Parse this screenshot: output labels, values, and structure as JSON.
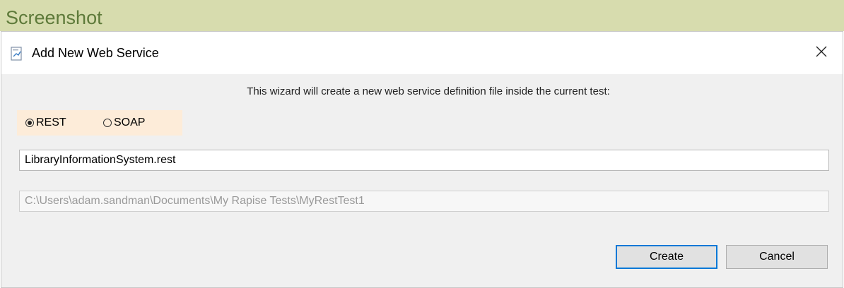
{
  "banner": {
    "title": "Screenshot"
  },
  "dialog": {
    "title": "Add New Web Service",
    "title_icon": "document-icon",
    "close_icon": "close-icon",
    "intro_text": "This wizard will create a new web service definition file inside the current test:",
    "service_type": {
      "options": [
        "REST",
        "SOAP"
      ],
      "selected": "REST"
    },
    "file_name": {
      "value": "LibraryInformationSystem.rest"
    },
    "folder_path": {
      "value": "C:\\Users\\adam.sandman\\Documents\\My Rapise Tests\\MyRestTest1"
    },
    "buttons": {
      "create": "Create",
      "cancel": "Cancel"
    }
  },
  "colors": {
    "banner_bg": "#d7dcae",
    "banner_text": "#5e7a3a",
    "radio_group_bg": "#fdecd9",
    "primary_border": "#0078d7"
  }
}
